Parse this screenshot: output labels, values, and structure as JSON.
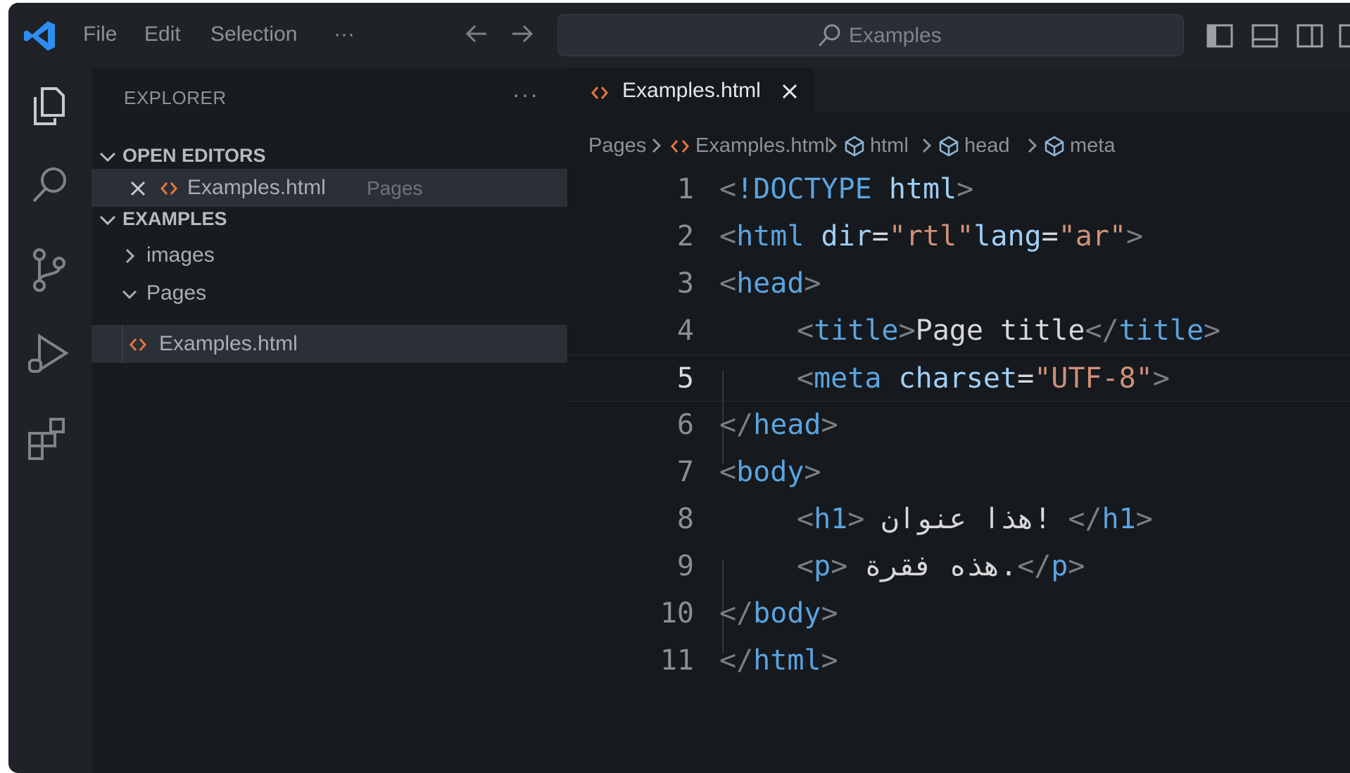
{
  "titlebar": {
    "menu": [
      "File",
      "Edit",
      "Selection",
      "···"
    ],
    "search_label": "Examples"
  },
  "activity_bar": {
    "icons": [
      "explorer-icon",
      "search-icon",
      "source-control-icon",
      "run-debug-icon",
      "extensions-icon"
    ]
  },
  "sidebar": {
    "title": "EXPLORER",
    "more": "···",
    "open_editors": {
      "label": "OPEN EDITORS",
      "items": [
        {
          "name": "Examples.html",
          "folder": "Pages"
        }
      ]
    },
    "workspace": {
      "label": "EXAMPLES",
      "folders": [
        {
          "name": "images",
          "expanded": false
        },
        {
          "name": "Pages",
          "expanded": true,
          "files": [
            "Examples.html"
          ]
        }
      ]
    }
  },
  "editor": {
    "tab": {
      "label": "Examples.html"
    },
    "breadcrumbs": [
      "Pages",
      "Examples.html",
      "html",
      "head",
      "meta"
    ],
    "current_line": 5,
    "lines": [
      {
        "n": "1",
        "tokens": [
          {
            "t": "br",
            "v": "<"
          },
          {
            "t": "doc",
            "v": "!DOCTYPE"
          },
          {
            "t": "txt",
            "v": " "
          },
          {
            "t": "attr",
            "v": "html"
          },
          {
            "t": "br",
            "v": ">"
          }
        ]
      },
      {
        "n": "2",
        "tokens": [
          {
            "t": "br",
            "v": "<"
          },
          {
            "t": "tag",
            "v": "html"
          },
          {
            "t": "txt",
            "v": " "
          },
          {
            "t": "attr",
            "v": "dir"
          },
          {
            "t": "txt",
            "v": "="
          },
          {
            "t": "str",
            "v": "\"rtl\""
          },
          {
            "t": "attr",
            "v": "lang"
          },
          {
            "t": "txt",
            "v": "="
          },
          {
            "t": "str",
            "v": "\"ar\""
          },
          {
            "t": "br",
            "v": ">"
          }
        ]
      },
      {
        "n": "3",
        "tokens": [
          {
            "t": "br",
            "v": "<"
          },
          {
            "t": "tag",
            "v": "head"
          },
          {
            "t": "br",
            "v": ">"
          }
        ]
      },
      {
        "n": "4",
        "indent": 1,
        "tokens": [
          {
            "t": "br",
            "v": "<"
          },
          {
            "t": "tag",
            "v": "title"
          },
          {
            "t": "br",
            "v": ">"
          },
          {
            "t": "txt",
            "v": "Page title"
          },
          {
            "t": "br",
            "v": "</"
          },
          {
            "t": "tag",
            "v": "title"
          },
          {
            "t": "br",
            "v": ">"
          }
        ]
      },
      {
        "n": "5",
        "indent": 1,
        "tokens": [
          {
            "t": "br",
            "v": "<"
          },
          {
            "t": "tag",
            "v": "meta"
          },
          {
            "t": "txt",
            "v": " "
          },
          {
            "t": "attr",
            "v": "charset"
          },
          {
            "t": "txt",
            "v": "="
          },
          {
            "t": "str",
            "v": "\"UTF-8\""
          },
          {
            "t": "br",
            "v": ">"
          }
        ]
      },
      {
        "n": "6",
        "tokens": [
          {
            "t": "br",
            "v": "</"
          },
          {
            "t": "tag",
            "v": "head"
          },
          {
            "t": "br",
            "v": ">"
          }
        ]
      },
      {
        "n": "7",
        "tokens": [
          {
            "t": "br",
            "v": "<"
          },
          {
            "t": "tag",
            "v": "body"
          },
          {
            "t": "br",
            "v": ">"
          }
        ]
      },
      {
        "n": "8",
        "indent": 1,
        "tokens": [
          {
            "t": "br",
            "v": "<"
          },
          {
            "t": "tag",
            "v": "h1"
          },
          {
            "t": "br",
            "v": ">"
          },
          {
            "t": "txt",
            "v": " هذا عنوان! "
          },
          {
            "t": "br",
            "v": "</"
          },
          {
            "t": "tag",
            "v": "h1"
          },
          {
            "t": "br",
            "v": ">"
          }
        ]
      },
      {
        "n": "9",
        "indent": 1,
        "tokens": [
          {
            "t": "br",
            "v": "<"
          },
          {
            "t": "tag",
            "v": "p"
          },
          {
            "t": "br",
            "v": ">"
          },
          {
            "t": "txt",
            "v": " هذه فقرة."
          },
          {
            "t": "br",
            "v": "</"
          },
          {
            "t": "tag",
            "v": "p"
          },
          {
            "t": "br",
            "v": ">"
          }
        ]
      },
      {
        "n": "10",
        "tokens": [
          {
            "t": "br",
            "v": "</"
          },
          {
            "t": "tag",
            "v": "body"
          },
          {
            "t": "br",
            "v": ">"
          }
        ]
      },
      {
        "n": "11",
        "tokens": [
          {
            "t": "br",
            "v": "</"
          },
          {
            "t": "tag",
            "v": "html"
          },
          {
            "t": "br",
            "v": ">"
          }
        ]
      }
    ]
  }
}
